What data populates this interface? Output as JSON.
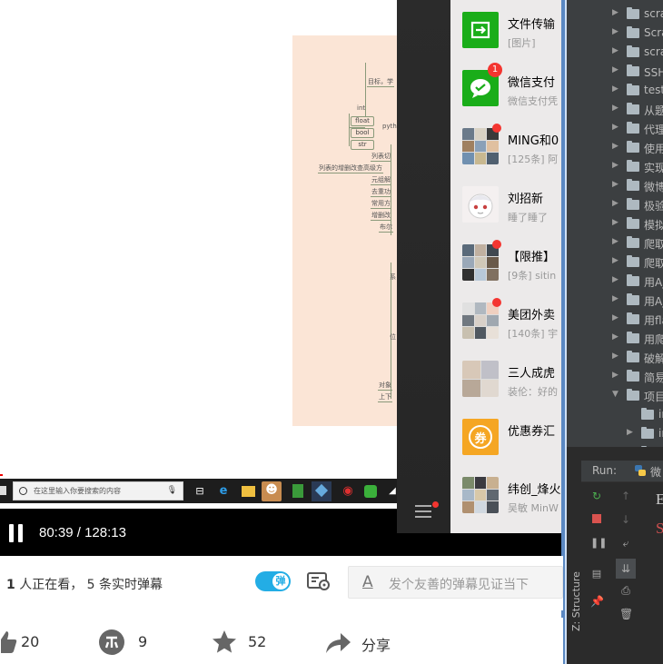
{
  "mindmap": {
    "nodes": [
      "目标，学",
      "int",
      "float",
      "bool",
      "str",
      "pyth",
      "列表切",
      "列表的增删改查高级方",
      "元组解",
      "去重功",
      "常用方",
      "增删改",
      "布尔",
      "系",
      "位",
      "对象",
      "上下"
    ]
  },
  "taskbar": {
    "search_placeholder": "在这里输入你要搜索的内容"
  },
  "player": {
    "current_time": "80:39",
    "separator": "/",
    "total_time": "128:13"
  },
  "wechat": {
    "chats": [
      {
        "name": "文件传输",
        "preview": "[图片]"
      },
      {
        "name": "微信支付",
        "preview": "微信支付凭",
        "badge": "1"
      },
      {
        "name": "MING和0",
        "preview": "[125条] 阿"
      },
      {
        "name": "刘招新",
        "preview": "睡了睡了"
      },
      {
        "name": "【限推】",
        "preview": "[9条] sitin"
      },
      {
        "name": "美团外卖",
        "preview": "[140条] 宇"
      },
      {
        "name": "三人成虎",
        "preview": "装伦：好的"
      },
      {
        "name": "优惠券汇",
        "preview": ""
      },
      {
        "name": "纬创_烽火",
        "preview": "吴敏 MinW"
      }
    ],
    "coupon_char": "券"
  },
  "ide": {
    "tree": [
      {
        "label": "scrap",
        "expanded": false
      },
      {
        "label": "Scrap",
        "expanded": false
      },
      {
        "label": "scrap",
        "expanded": false
      },
      {
        "label": "SSH登",
        "expanded": false
      },
      {
        "label": "test1",
        "expanded": false
      },
      {
        "label": "从题",
        "expanded": false
      },
      {
        "label": "代理",
        "expanded": false
      },
      {
        "label": "使用",
        "expanded": false
      },
      {
        "label": "实现",
        "expanded": false
      },
      {
        "label": "微博",
        "expanded": false
      },
      {
        "label": "极验",
        "expanded": false
      },
      {
        "label": "模拟",
        "expanded": false
      },
      {
        "label": "爬取",
        "expanded": false
      },
      {
        "label": "爬取",
        "expanded": false
      },
      {
        "label": "用Aja",
        "expanded": false
      },
      {
        "label": "用Aja",
        "expanded": false
      },
      {
        "label": "用fla",
        "expanded": false
      },
      {
        "label": "用爬",
        "expanded": false
      },
      {
        "label": "破解",
        "expanded": false
      },
      {
        "label": "简易",
        "expanded": false
      },
      {
        "label": "项目",
        "expanded": true
      },
      {
        "label": "in",
        "expanded": false
      },
      {
        "label": "in",
        "expanded": false
      },
      {
        "label": "m",
        "expanded": false
      }
    ],
    "run_label": "Run:",
    "run_tab": "微",
    "structure_label": "Z: Structure",
    "console_chars": [
      "E",
      "S"
    ]
  },
  "info": {
    "viewer_count": "1",
    "viewer_text": "人正在看，",
    "danmu_count": "5",
    "danmu_text": "条实时弹幕",
    "toggle_char": "弹",
    "danmu_placeholder": "发个友善的弹幕见证当下",
    "a_char": "A"
  },
  "actions": {
    "like_count": "20",
    "coin_count": "9",
    "star_count": "52",
    "share_label": "分享"
  },
  "colors": {
    "wechat_green": "#1aad19",
    "badge_red": "#f43530",
    "toggle_blue": "#23ade5",
    "ide_bg": "#3c3f41",
    "mindmap_bg": "#fbe5d6"
  }
}
